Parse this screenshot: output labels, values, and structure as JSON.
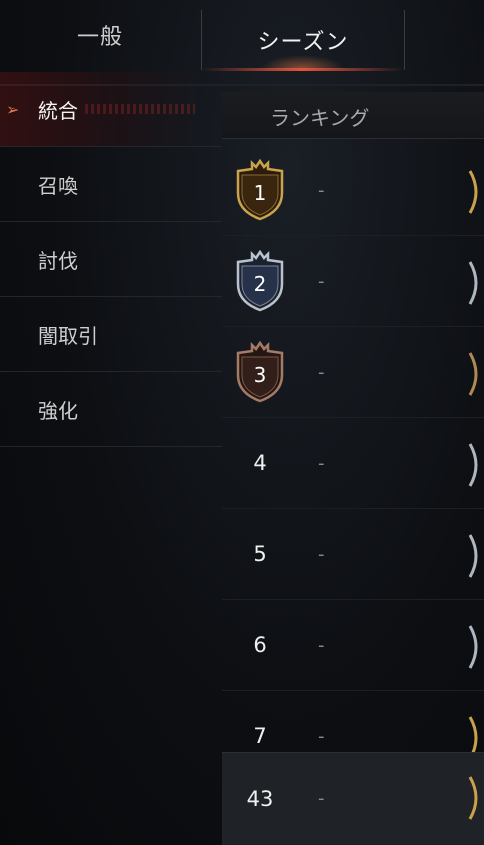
{
  "tabs": [
    {
      "label": "一般",
      "active": false
    },
    {
      "label": "シーズン",
      "active": true
    }
  ],
  "sidebar": {
    "items": [
      {
        "label": "統合",
        "active": true
      },
      {
        "label": "召喚",
        "active": false
      },
      {
        "label": "討伐",
        "active": false
      },
      {
        "label": "闇取引",
        "active": false
      },
      {
        "label": "強化",
        "active": false
      }
    ]
  },
  "ranking": {
    "header": "ランキング",
    "rows": [
      {
        "rank": "1",
        "value": "-",
        "badge": "gold-shield"
      },
      {
        "rank": "2",
        "value": "-",
        "badge": "silver-shield"
      },
      {
        "rank": "3",
        "value": "-",
        "badge": "bronze-shield"
      },
      {
        "rank": "4",
        "value": "-"
      },
      {
        "rank": "5",
        "value": "-"
      },
      {
        "rank": "6",
        "value": "-"
      },
      {
        "rank": "7",
        "value": "-"
      }
    ],
    "self_row": {
      "rank": "43",
      "value": "-"
    }
  },
  "colors": {
    "accent": "#e0553a",
    "gold": "#c9a24b",
    "silver": "#b9c2cc",
    "bronze": "#a57a66"
  }
}
